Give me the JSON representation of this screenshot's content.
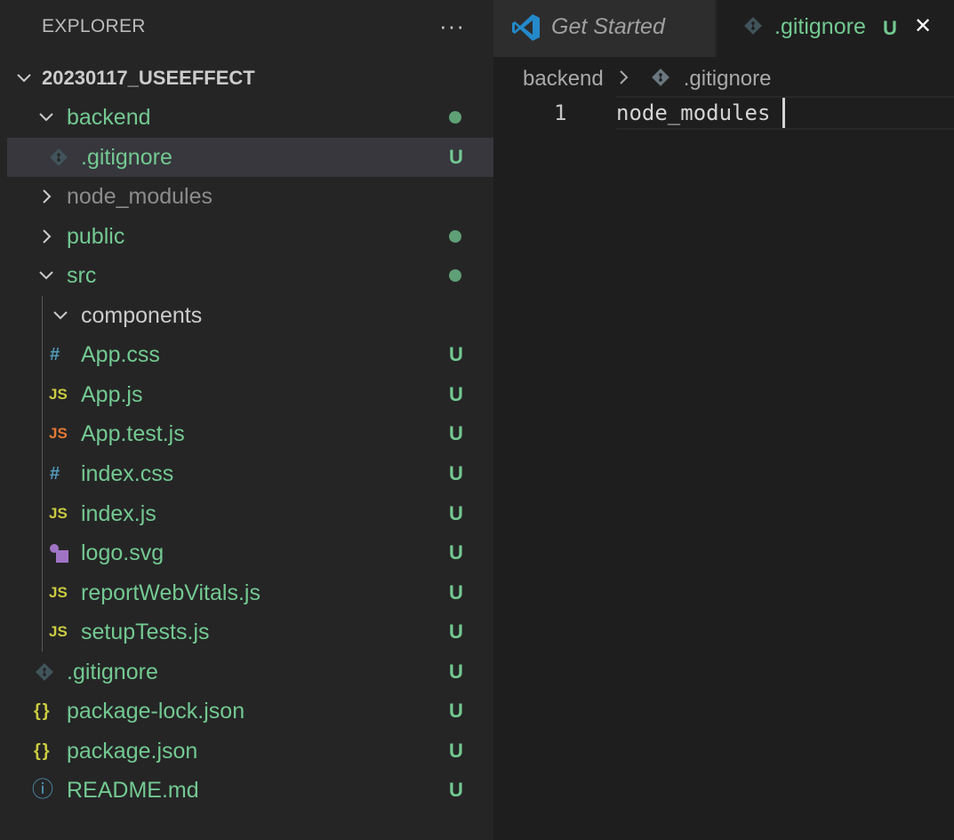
{
  "explorer": {
    "title": "EXPLORER",
    "more_label": "···",
    "root": "20230117_USEEFFECT"
  },
  "colors": {
    "untracked": "#73c991",
    "folder_default": "#cccccc",
    "ignored": "#8c8c8c",
    "js_icon": "#cbcb41",
    "css_icon": "#519aba",
    "test_icon": "#e37933",
    "svg_icon": "#a074c4",
    "git_icon": "#41535b",
    "info_icon": "#519aba",
    "vscode_blue": "#2489ca"
  },
  "tree": [
    {
      "label": "backend",
      "status": "",
      "icon": "chevron-down-icon"
    },
    {
      "label": ".gitignore",
      "status": "U",
      "icon": "git-icon"
    },
    {
      "label": "node_modules",
      "status": "",
      "icon": "chevron-right-icon"
    },
    {
      "label": "public",
      "status": "",
      "icon": "chevron-right-icon"
    },
    {
      "label": "src",
      "status": "",
      "icon": "chevron-down-icon"
    },
    {
      "label": "components",
      "status": "",
      "icon": "chevron-down-icon"
    },
    {
      "label": "App.css",
      "status": "U",
      "icon": "css-icon",
      "glyph": "#"
    },
    {
      "label": "App.js",
      "status": "U",
      "icon": "js-icon",
      "glyph": "JS"
    },
    {
      "label": "App.test.js",
      "status": "U",
      "icon": "test-js-icon",
      "glyph": "JS"
    },
    {
      "label": "index.css",
      "status": "U",
      "icon": "css-icon",
      "glyph": "#"
    },
    {
      "label": "index.js",
      "status": "U",
      "icon": "js-icon",
      "glyph": "JS"
    },
    {
      "label": "logo.svg",
      "status": "U",
      "icon": "svg-icon"
    },
    {
      "label": "reportWebVitals.js",
      "status": "U",
      "icon": "js-icon",
      "glyph": "JS"
    },
    {
      "label": "setupTests.js",
      "status": "U",
      "icon": "js-icon",
      "glyph": "JS"
    },
    {
      "label": ".gitignore",
      "status": "U",
      "icon": "git-icon"
    },
    {
      "label": "package-lock.json",
      "status": "U",
      "icon": "json-icon",
      "glyph": "{}"
    },
    {
      "label": "package.json",
      "status": "U",
      "icon": "json-icon",
      "glyph": "{}"
    },
    {
      "label": "README.md",
      "status": "U",
      "icon": "info-icon",
      "glyph": "ⓘ"
    }
  ],
  "tabs": [
    {
      "label": "Get Started",
      "status": ""
    },
    {
      "label": ".gitignore",
      "status": "U",
      "close": "✕"
    }
  ],
  "breadcrumb": {
    "folder": "backend",
    "separator": "〉",
    "file": ".gitignore"
  },
  "editor": {
    "line_number": "1",
    "content": "node_modules"
  }
}
